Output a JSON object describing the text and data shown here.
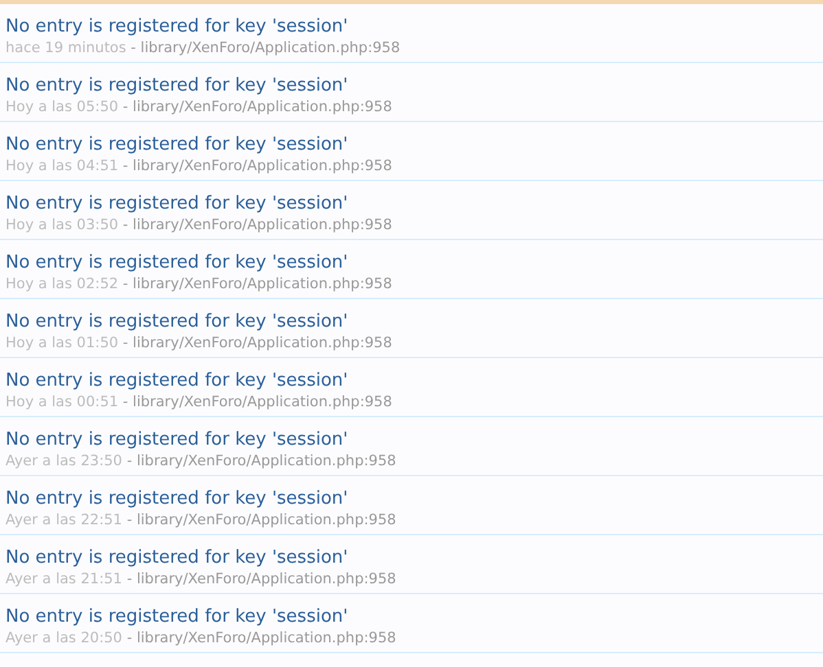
{
  "log_entries": [
    {
      "message": "No entry is registered for key 'session'",
      "time": "hace 19 minutos",
      "location": "- library/XenForo/Application.php:958"
    },
    {
      "message": "No entry is registered for key 'session'",
      "time": "Hoy a las 05:50",
      "location": "- library/XenForo/Application.php:958"
    },
    {
      "message": "No entry is registered for key 'session'",
      "time": "Hoy a las 04:51",
      "location": "- library/XenForo/Application.php:958"
    },
    {
      "message": "No entry is registered for key 'session'",
      "time": "Hoy a las 03:50",
      "location": "- library/XenForo/Application.php:958"
    },
    {
      "message": "No entry is registered for key 'session'",
      "time": "Hoy a las 02:52",
      "location": "- library/XenForo/Application.php:958"
    },
    {
      "message": "No entry is registered for key 'session'",
      "time": "Hoy a las 01:50",
      "location": "- library/XenForo/Application.php:958"
    },
    {
      "message": "No entry is registered for key 'session'",
      "time": "Hoy a las 00:51",
      "location": "- library/XenForo/Application.php:958"
    },
    {
      "message": "No entry is registered for key 'session'",
      "time": "Ayer a las 23:50",
      "location": "- library/XenForo/Application.php:958"
    },
    {
      "message": "No entry is registered for key 'session'",
      "time": "Ayer a las 22:51",
      "location": "- library/XenForo/Application.php:958"
    },
    {
      "message": "No entry is registered for key 'session'",
      "time": "Ayer a las 21:51",
      "location": "- library/XenForo/Application.php:958"
    },
    {
      "message": "No entry is registered for key 'session'",
      "time": "Ayer a las 20:50",
      "location": "- library/XenForo/Application.php:958"
    }
  ]
}
